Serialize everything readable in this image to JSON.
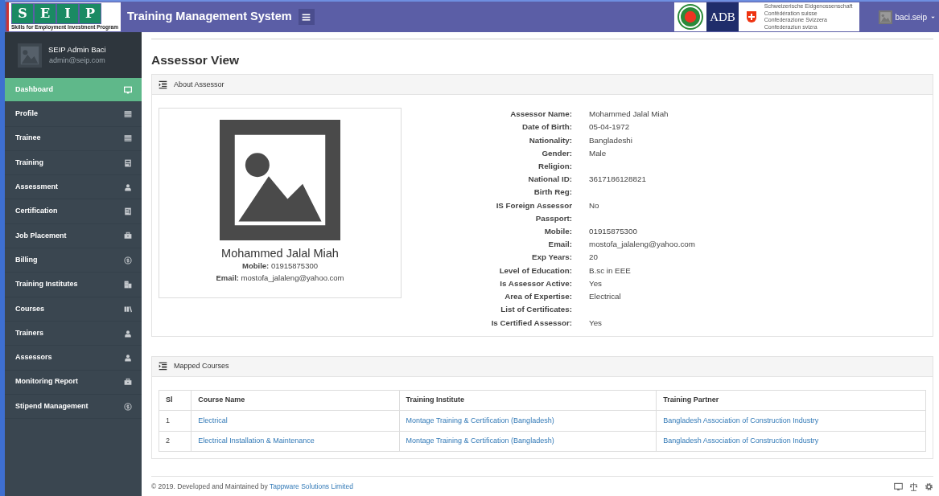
{
  "header": {
    "logo": {
      "letters": [
        "S",
        "E",
        "I",
        "P"
      ],
      "tagline": "Skills for Employment Investment Program"
    },
    "title": "Training Management System",
    "partner_logos": [
      {
        "kind": "emblem"
      },
      {
        "kind": "adb",
        "text": "ADB"
      },
      {
        "kind": "swiss",
        "lines": [
          "Schweizerische Eidgenossenschaft",
          "Confédération suisse",
          "Confederazione Svizzera",
          "Confederaziun svizra"
        ]
      }
    ],
    "user": {
      "name": "baci.seip"
    }
  },
  "sidebar": {
    "user": {
      "name": "SEIP Admin Baci",
      "email": "admin@seip.com"
    },
    "items": [
      {
        "label": "Dashboard",
        "kind": "monitor",
        "selected": true
      },
      {
        "label": "Profile",
        "kind": "list",
        "selected": false
      },
      {
        "label": "Trainee",
        "kind": "list",
        "selected": false
      },
      {
        "label": "Training",
        "kind": "calculator",
        "selected": false
      },
      {
        "label": "Assessment",
        "kind": "person",
        "selected": false
      },
      {
        "label": "Certification",
        "kind": "document",
        "selected": false
      },
      {
        "label": "Job Placement",
        "kind": "briefcase",
        "selected": false
      },
      {
        "label": "Billing",
        "kind": "coin",
        "selected": false
      },
      {
        "label": "Training Institutes",
        "kind": "building",
        "selected": false
      },
      {
        "label": "Courses",
        "kind": "books",
        "selected": false
      },
      {
        "label": "Trainers",
        "kind": "person",
        "selected": false
      },
      {
        "label": "Assessors",
        "kind": "person",
        "selected": false
      },
      {
        "label": "Monitoring Report",
        "kind": "briefcase",
        "selected": false
      },
      {
        "label": "Stipend Management",
        "kind": "coin",
        "selected": false
      }
    ]
  },
  "page_title": "Assessor View",
  "about_panel": {
    "title": "About Assessor",
    "profile_card": {
      "name": "Mohammed Jalal Miah",
      "mobile_label": "Mobile:",
      "mobile": "01915875300",
      "email_label": "Email:",
      "email": "mostofa_jalaleng@yahoo.com"
    },
    "details": [
      {
        "label": "Assessor Name:",
        "value": "Mohammed Jalal Miah"
      },
      {
        "label": "Date of Birth:",
        "value": "05-04-1972"
      },
      {
        "label": "Nationality:",
        "value": "Bangladeshi"
      },
      {
        "label": "Gender:",
        "value": "Male"
      },
      {
        "label": "Religion:"
      },
      {
        "label": "National ID:",
        "value": "3617186128821"
      },
      {
        "label": "Birth Reg:"
      },
      {
        "label": "IS Foreign Assessor",
        "value": "No"
      },
      {
        "label": "Passport:"
      },
      {
        "label": "Mobile:",
        "value": "01915875300"
      },
      {
        "label": "Email:",
        "value": "mostofa_jalaleng@yahoo.com"
      },
      {
        "label": "Exp Years:",
        "value": "20"
      },
      {
        "label": "Level of Education:",
        "value": "B.sc in EEE"
      },
      {
        "label": "Is Assessor Active:",
        "value": "Yes"
      },
      {
        "label": "Area of Expertise:",
        "value": "Electrical"
      },
      {
        "label": "List of Certificates:"
      },
      {
        "label": "Is Certified Assessor:",
        "value": "Yes"
      }
    ]
  },
  "courses_panel": {
    "title": "Mapped Courses",
    "table": {
      "columns": [
        "Sl",
        "Course Name",
        "Training Institute",
        "Training Partner"
      ],
      "rows": [
        [
          "1",
          "Electrical",
          "Montage Training & Certification (Bangladesh)",
          "Bangladesh Association of Construction Industry"
        ],
        [
          "2",
          "Electrical Installation & Maintenance",
          "Montage Training & Certification (Bangladesh)",
          "Bangladesh Association of Construction Industry"
        ]
      ]
    }
  },
  "footer": {
    "text": "© 2019. Developed and Maintained by ",
    "link": "Tappware Solutions Limited"
  }
}
